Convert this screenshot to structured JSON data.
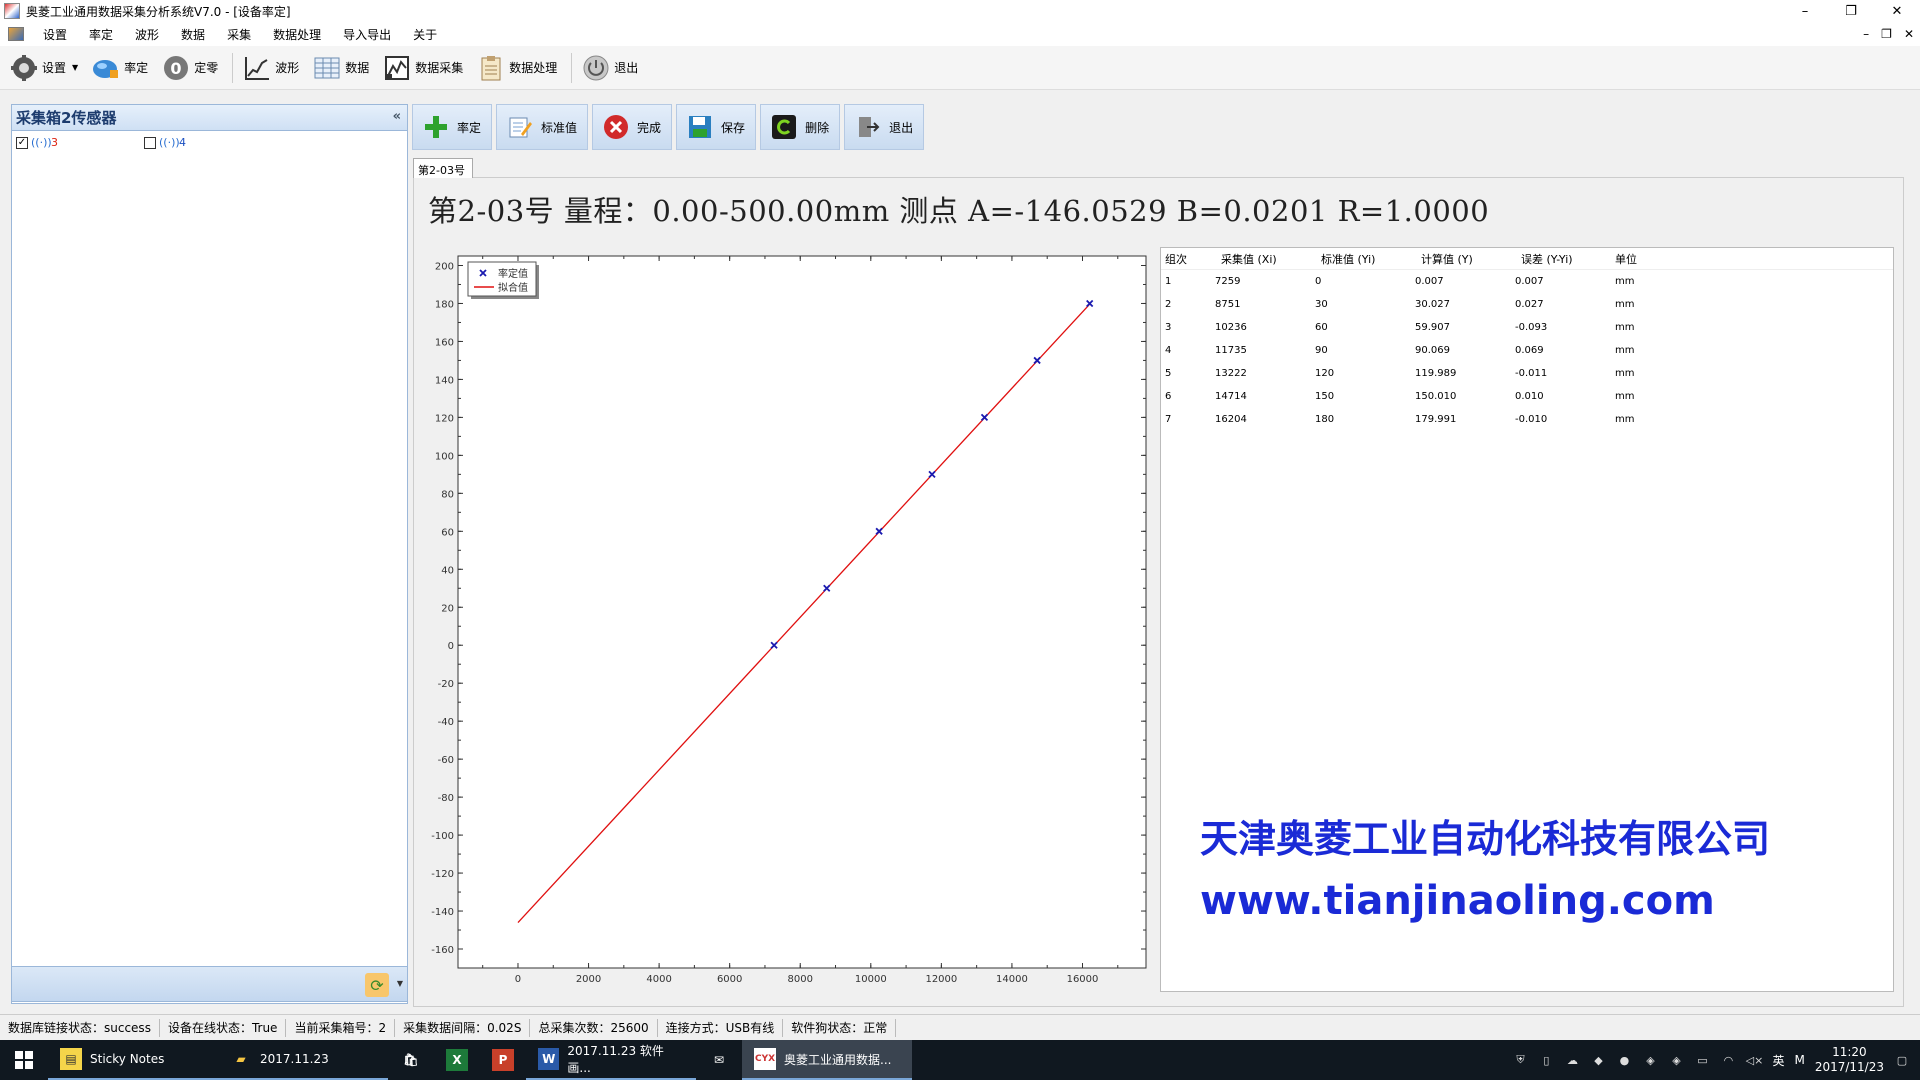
{
  "window": {
    "title": "奥菱工业通用数据采集分析系统V7.0 - [设备率定]",
    "min": "–",
    "max": "❐",
    "close": "✕"
  },
  "menu": {
    "items": [
      "设置",
      "率定",
      "波形",
      "数据",
      "采集",
      "数据处理",
      "导入导出",
      "关于"
    ],
    "mdi_min": "–",
    "mdi_restore": "❐",
    "mdi_close": "✕"
  },
  "toolbar": {
    "items": [
      {
        "label": "设置",
        "icon": "gear-icon"
      },
      {
        "label": "率定",
        "icon": "calibrate-icon"
      },
      {
        "label": "定零",
        "icon": "zero-icon"
      },
      {
        "label": "波形",
        "icon": "waveform-icon"
      },
      {
        "label": "数据",
        "icon": "grid-icon"
      },
      {
        "label": "数据采集",
        "icon": "acquisition-icon"
      },
      {
        "label": "数据处理",
        "icon": "clipboard-icon"
      },
      {
        "label": "退出",
        "icon": "power-icon"
      }
    ]
  },
  "left_panel": {
    "title": "采集箱2传感器",
    "collapse": "«",
    "sensors": [
      {
        "num": "3",
        "checked": true
      },
      {
        "num": "4",
        "checked": false
      }
    ],
    "splitter": "....."
  },
  "actions": [
    {
      "label": "率定",
      "icon": "plus-icon",
      "color": "#2ea22e"
    },
    {
      "label": "标准值",
      "icon": "edit-icon",
      "color": "#2a6fd1"
    },
    {
      "label": "完成",
      "icon": "cancel-icon",
      "color": "#d12a2a"
    },
    {
      "label": "保存",
      "icon": "save-icon",
      "color": "#2a7fc0"
    },
    {
      "label": "删除",
      "icon": "delete-icon",
      "color": "#1f6a2a"
    },
    {
      "label": "退出",
      "icon": "exit-icon",
      "color": "#444444"
    }
  ],
  "tab": {
    "label": "第2-03号"
  },
  "calibration": {
    "text": "第2-03号 量程：0.00-500.00mm 测点 A=-146.0529 B=0.0201 R=1.0000"
  },
  "chart_data": {
    "type": "scatter",
    "x": [
      7259,
      8751,
      10236,
      11735,
      13222,
      14714,
      16204
    ],
    "y": [
      0,
      30,
      60,
      90,
      120,
      150,
      180
    ],
    "fit_line": {
      "x": [
        0,
        16204
      ],
      "y": [
        -146.0529,
        179.6475
      ]
    },
    "xlim": [
      -1700,
      17800
    ],
    "ylim": [
      -170,
      205
    ],
    "xticks": [
      0,
      2000,
      4000,
      6000,
      8000,
      10000,
      12000,
      14000,
      16000
    ],
    "yticks": [
      200,
      180,
      160,
      140,
      120,
      100,
      80,
      60,
      40,
      20,
      0,
      -20,
      -40,
      -60,
      -80,
      -100,
      -120,
      -140,
      -160
    ],
    "legend": [
      {
        "name": "率定值",
        "marker": "x",
        "color": "#1a1ab0"
      },
      {
        "name": "拟合值",
        "marker": "line",
        "color": "#e01010"
      }
    ],
    "legend_position": "top-left",
    "point_color": "#1a1ab0",
    "line_color": "#e01010"
  },
  "table": {
    "headers": [
      "组次",
      "采集值 (Xi)",
      "标准值 (Yi)",
      "计算值 (Y)",
      "误差 (Y-Yi)",
      "单位"
    ],
    "rows": [
      [
        "1",
        "7259",
        "0",
        "0.007",
        "0.007",
        "mm"
      ],
      [
        "2",
        "8751",
        "30",
        "30.027",
        "0.027",
        "mm"
      ],
      [
        "3",
        "10236",
        "60",
        "59.907",
        "-0.093",
        "mm"
      ],
      [
        "4",
        "11735",
        "90",
        "90.069",
        "0.069",
        "mm"
      ],
      [
        "5",
        "13222",
        "120",
        "119.989",
        "-0.011",
        "mm"
      ],
      [
        "6",
        "14714",
        "150",
        "150.010",
        "0.010",
        "mm"
      ],
      [
        "7",
        "16204",
        "180",
        "179.991",
        "-0.010",
        "mm"
      ]
    ]
  },
  "company": {
    "name": "天津奥菱工业自动化科技有限公司",
    "website": "www.tianjinaoling.com",
    "color": "#1a2ad6"
  },
  "status": {
    "items": [
      "数据库链接状态：success",
      "设备在线状态：True",
      "当前采集箱号：2",
      "采集数据间隔：0.02S",
      "总采集次数：25600",
      "连接方式：USB有线",
      "软件狗状态：正常"
    ]
  },
  "taskbar": {
    "apps": [
      {
        "label": "Sticky Notes",
        "icon": "sticky-notes-icon"
      },
      {
        "label": "2017.11.23",
        "icon": "folder-icon"
      },
      {
        "label": "",
        "icon": "store-icon"
      },
      {
        "label": "",
        "icon": "excel-icon"
      },
      {
        "label": "",
        "icon": "powerpoint-icon"
      },
      {
        "label": "2017.11.23 软件画...",
        "icon": "word-icon"
      },
      {
        "label": "",
        "icon": "mail-icon"
      },
      {
        "label": "奥菱工业通用数据...",
        "icon": "aoling-app-icon"
      }
    ],
    "ime": "英",
    "ime2": "M",
    "time": "11:20",
    "date": "2017/11/23"
  }
}
